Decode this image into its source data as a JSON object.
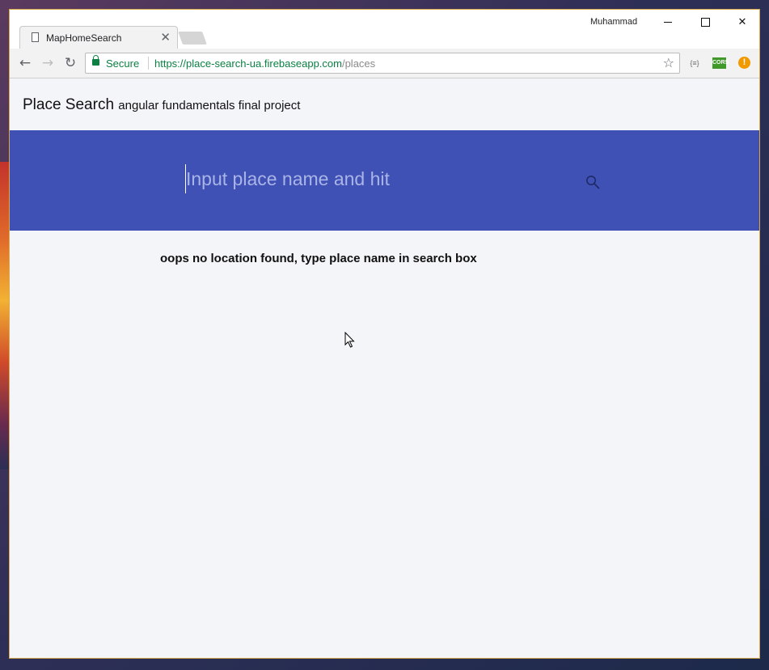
{
  "browser": {
    "tab_title": "MapHomeSearch",
    "profile_name": "Muhammad",
    "secure_label": "Secure",
    "url_scheme": "https://",
    "url_host": "place-search-ua.firebaseapp.com",
    "url_path": "/places",
    "extensions": {
      "json_label": "{≡}",
      "cors_label": "CORS",
      "alert_label": "!"
    }
  },
  "header": {
    "title": "Place Search",
    "subtitle": "angular fundamentals final project"
  },
  "search": {
    "placeholder": "Input place name and hit"
  },
  "main": {
    "message": "oops no location found, type place name in search box"
  },
  "colors": {
    "search_band": "#3f51b5",
    "page_background": "#f4f5f9",
    "secure_green": "#0b8043"
  },
  "icons": [
    "page-icon",
    "close-icon",
    "back-icon",
    "forward-icon",
    "reload-icon",
    "lock-icon",
    "star-icon",
    "search-icon",
    "mouse-cursor-icon"
  ]
}
